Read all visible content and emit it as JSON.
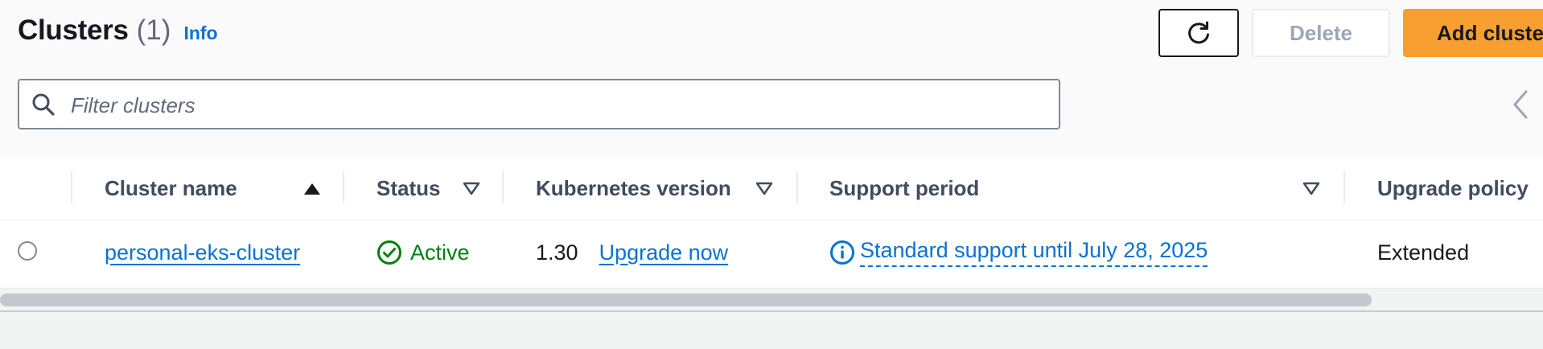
{
  "header": {
    "title": "Clusters",
    "count": "(1)",
    "info_link": "Info"
  },
  "actions": {
    "refresh_icon": "refresh-icon",
    "delete_label": "Delete",
    "add_label": "Add cluster"
  },
  "filter": {
    "placeholder": "Filter clusters",
    "icon": "search-icon"
  },
  "pagination": {
    "prev_icon": "chevron-left-icon"
  },
  "table": {
    "columns": [
      {
        "label": "Cluster name",
        "sort": "ascending"
      },
      {
        "label": "Status",
        "sort": "unsorted"
      },
      {
        "label": "Kubernetes version",
        "sort": "unsorted"
      },
      {
        "label": "Support period",
        "sort": "unsorted"
      },
      {
        "label": "Upgrade policy",
        "sort": ""
      }
    ],
    "rows": [
      {
        "cluster_name": "personal-eks-cluster",
        "status": "Active",
        "kubernetes_version": "1.30",
        "upgrade_link": "Upgrade now",
        "support_period": "Standard support until July 28, 2025",
        "upgrade_policy": "Extended"
      }
    ]
  },
  "colors": {
    "link": "#0972d3",
    "active_status": "#037f0c",
    "primary_button": "#f89f32"
  }
}
